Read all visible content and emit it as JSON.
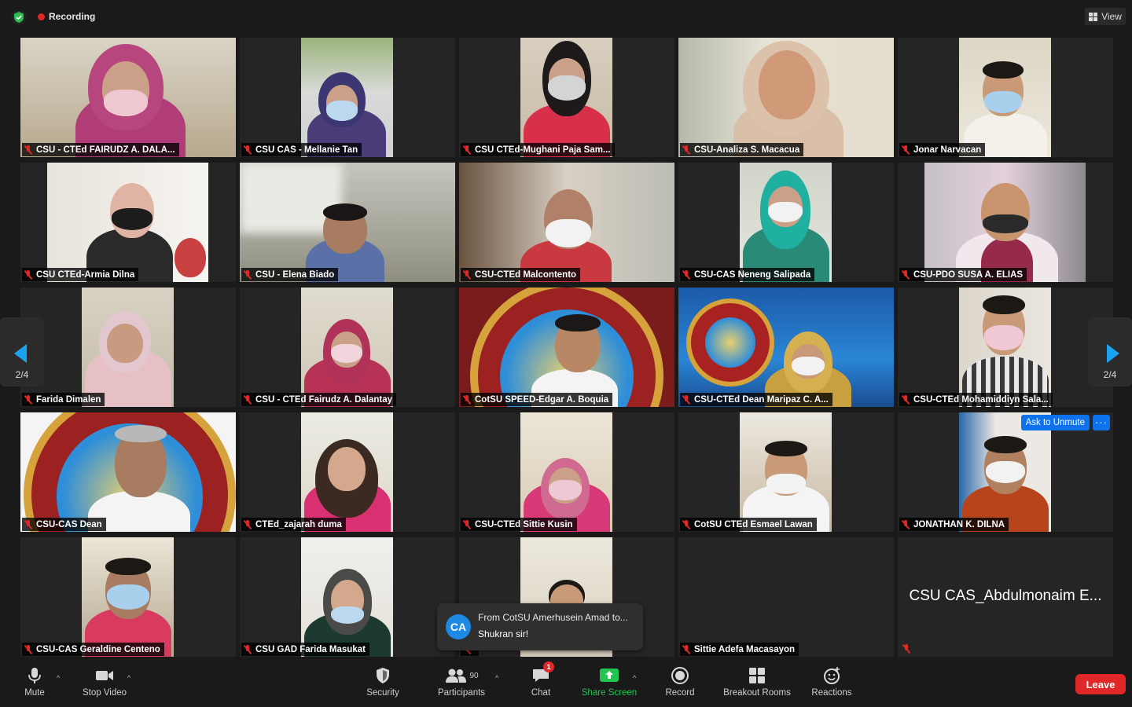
{
  "topbar": {
    "recording_label": "Recording",
    "view_label": "View"
  },
  "gallery": {
    "tiles": [
      {
        "name": "CSU - CTEd  FAIRUDZ A. DALA..."
      },
      {
        "name": "CSU CAS - Mellanie Tan"
      },
      {
        "name": "CSU CTEd-Mughani Paja  Sam..."
      },
      {
        "name": "CSU-Analiza S. Macacua"
      },
      {
        "name": "Jonar Narvacan"
      },
      {
        "name": "CSU CTEd-Armia Dilna"
      },
      {
        "name": "CSU - Elena Biado"
      },
      {
        "name": "CSU-CTEd Malcontento"
      },
      {
        "name": "CSU-CAS Neneng Salipada"
      },
      {
        "name": "CSU-PDO SUSA A. ELIAS"
      },
      {
        "name": "Farida Dimalen"
      },
      {
        "name": "CSU - CTEd Fairudz A. Dalantay"
      },
      {
        "name": "CotSU SPEED-Edgar A. Boquia"
      },
      {
        "name": "CSU-CTEd Dean Maripaz C. A..."
      },
      {
        "name": "CSU-CTEd Mohamiddiyn Sala..."
      },
      {
        "name": "CSU-CAS Dean"
      },
      {
        "name": "CTEd_zajarah duma"
      },
      {
        "name": "CSU-CTEd Sittie Kusin"
      },
      {
        "name": "CotSU CTEd Esmael Lawan"
      },
      {
        "name": "JONATHAN K. DILNA"
      },
      {
        "name": "CSU-CAS Geraldine Centeno"
      },
      {
        "name": "CSU GAD Farida Masukat"
      },
      {
        "name": ""
      },
      {
        "name": "Sittie Adefa Macasayon"
      },
      {
        "name": "CSU CAS_Abdulmonaim E..."
      }
    ],
    "ask_to_unmute_label": "Ask to Unmute",
    "more_label": "···"
  },
  "pager": {
    "left_page": "2/4",
    "right_page": "2/4"
  },
  "chat_toast": {
    "avatar_initials": "CA",
    "from": "From CotSU Amerhusein Amad to...",
    "message": "Shukran sir!"
  },
  "toolbar": {
    "mute_label": "Mute",
    "stop_video_label": "Stop Video",
    "security_label": "Security",
    "participants_label": "Participants",
    "participants_count": "90",
    "chat_label": "Chat",
    "chat_badge": "1",
    "share_screen_label": "Share Screen",
    "record_label": "Record",
    "breakout_label": "Breakout Rooms",
    "reactions_label": "Reactions",
    "leave_label": "Leave"
  },
  "colors": {
    "accent_blue": "#0e72ed",
    "share_green": "#23c552",
    "leave_red": "#e02828",
    "page_arrow": "#1aa3f0"
  }
}
